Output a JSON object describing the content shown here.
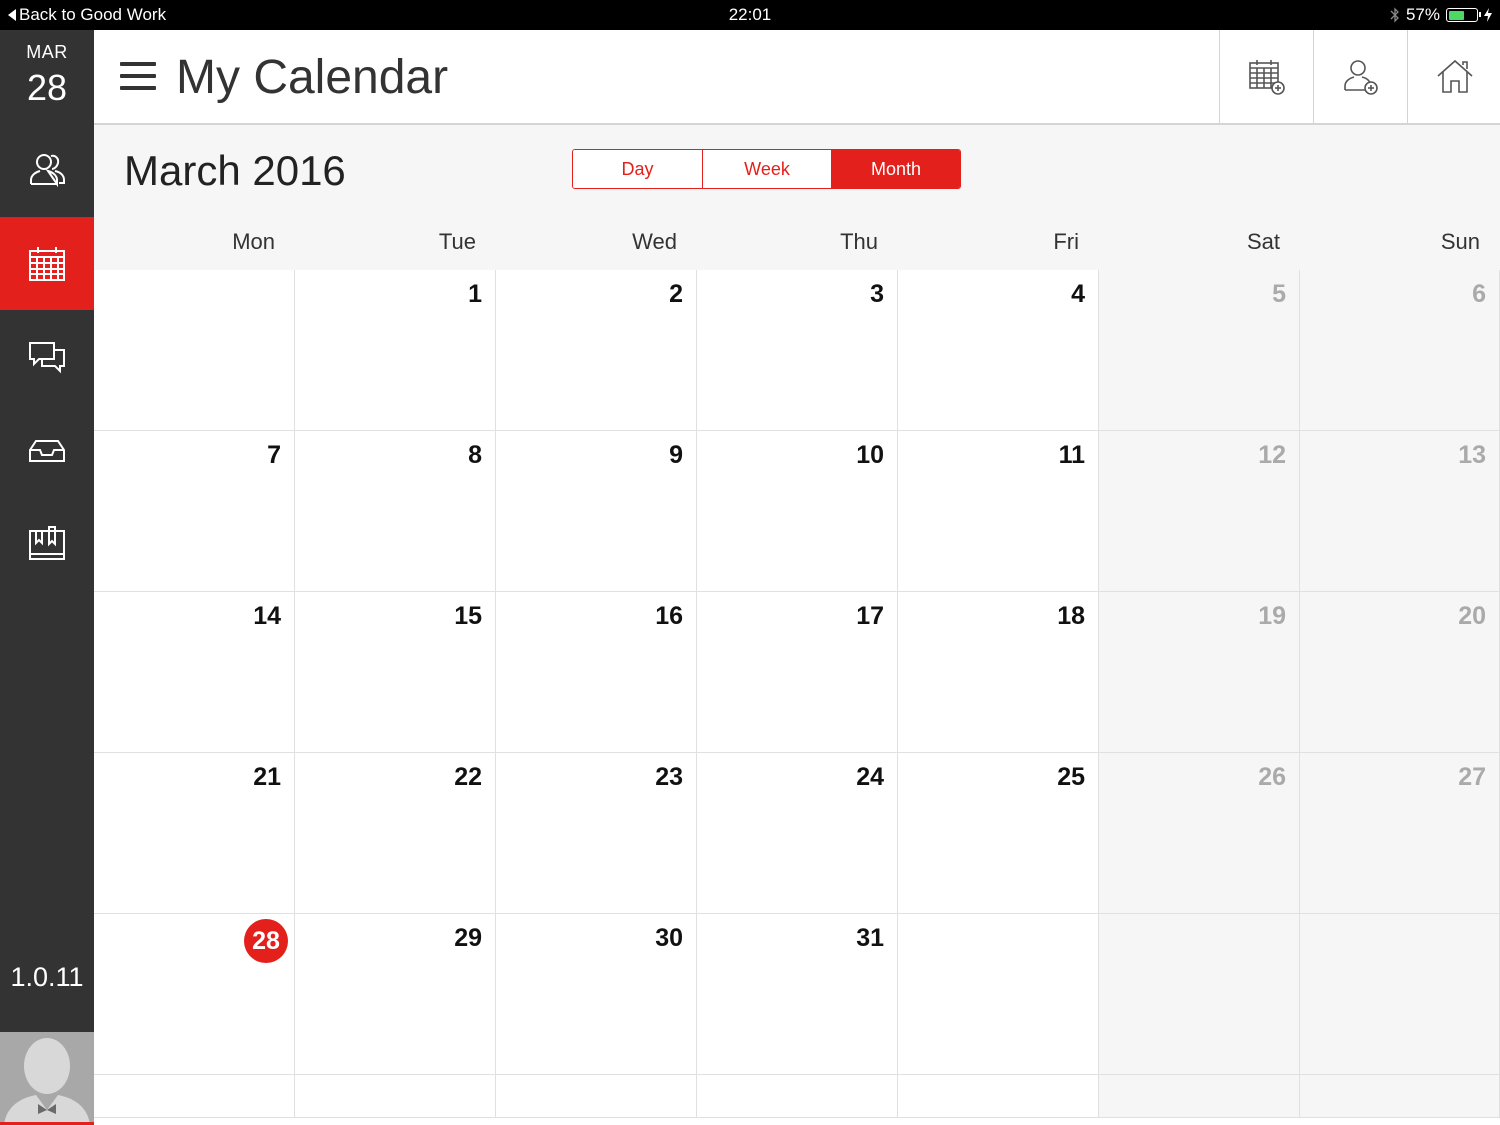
{
  "status_bar": {
    "back_label": "Back to Good Work",
    "time": "22:01",
    "battery": "57%",
    "battery_level": 0.57
  },
  "sidebar": {
    "date_month": "MAR",
    "date_day": "28",
    "items": [
      {
        "name": "sidebar-item-contacts",
        "icon": "people-icon",
        "active": false
      },
      {
        "name": "sidebar-item-calendar",
        "icon": "calendar-icon",
        "active": true
      },
      {
        "name": "sidebar-item-messages",
        "icon": "chat-icon",
        "active": false
      },
      {
        "name": "sidebar-item-inbox",
        "icon": "inbox-icon",
        "active": false
      },
      {
        "name": "sidebar-item-notes",
        "icon": "bookmarks-icon",
        "active": false
      }
    ],
    "version": "1.0.11"
  },
  "header": {
    "title": "My Calendar",
    "actions": [
      "add-event-icon",
      "add-person-icon",
      "home-icon"
    ]
  },
  "calendar": {
    "month_title": "March 2016",
    "views": [
      "Day",
      "Week",
      "Month"
    ],
    "active_view": "Month",
    "weekdays": [
      "Mon",
      "Tue",
      "Wed",
      "Thu",
      "Fri",
      "Sat",
      "Sun"
    ],
    "weeks": [
      [
        "",
        "1",
        "2",
        "3",
        "4",
        "5",
        "6"
      ],
      [
        "7",
        "8",
        "9",
        "10",
        "11",
        "12",
        "13"
      ],
      [
        "14",
        "15",
        "16",
        "17",
        "18",
        "19",
        "20"
      ],
      [
        "21",
        "22",
        "23",
        "24",
        "25",
        "26",
        "27"
      ],
      [
        "28",
        "29",
        "30",
        "31",
        "",
        "",
        ""
      ],
      [
        "",
        "",
        "",
        "",
        "",
        "",
        ""
      ]
    ],
    "today": "28"
  },
  "colors": {
    "accent": "#e3201b",
    "sidebar_bg": "#333333",
    "weekend_bg": "#f6f6f6"
  }
}
